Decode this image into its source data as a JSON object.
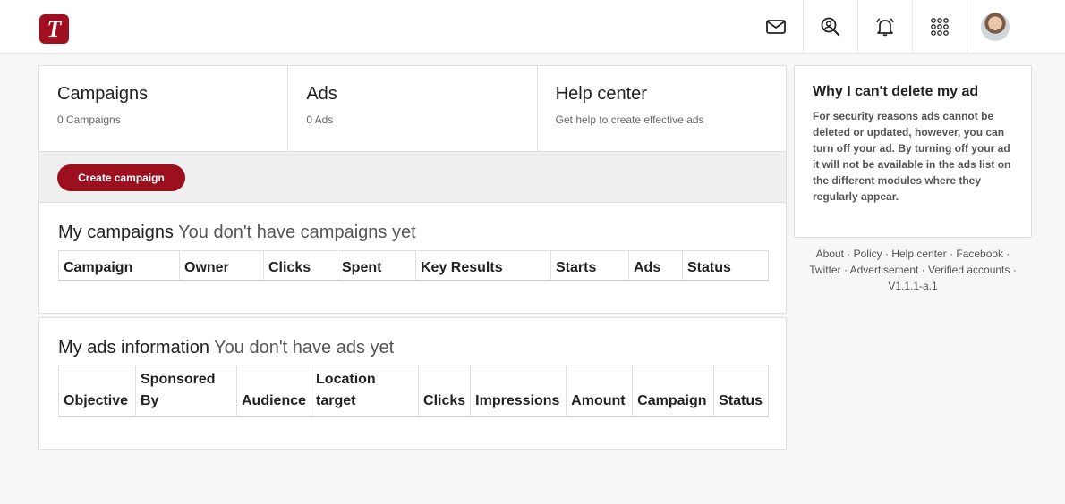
{
  "header": {
    "logo_letter": "T",
    "icons": [
      "mail-icon",
      "search-user-icon",
      "bell-icon",
      "apps-grid-icon"
    ]
  },
  "stats": [
    {
      "title": "Campaigns",
      "sub": "0 Campaigns"
    },
    {
      "title": "Ads",
      "sub": "0 Ads"
    },
    {
      "title": "Help center",
      "sub": "Get help to create effective ads"
    }
  ],
  "create_button": "Create campaign",
  "campaigns": {
    "title": "My campaigns",
    "subtitle": "You don't have campaigns yet",
    "columns": [
      "Campaign",
      "Owner",
      "Clicks",
      "Spent",
      "Key Results",
      "Starts",
      "Ads",
      "Status"
    ]
  },
  "ads": {
    "title": "My ads information",
    "subtitle": "You don't have ads yet",
    "columns": [
      "Objective",
      "Sponsored By",
      "Audience",
      "Location target",
      "Clicks",
      "Impressions",
      "Amount",
      "Campaign",
      "Status"
    ]
  },
  "sidebar": {
    "title": "Why I can't delete my ad",
    "body": "For security reasons ads cannot be deleted or updated, however, you can turn off your ad. By turning off your ad it will not be available in the ads list on the different modules where they regularly appear."
  },
  "footer": {
    "links": [
      "About",
      "Policy",
      "Help center",
      "Facebook",
      "Twitter",
      "Advertisement",
      "Verified accounts"
    ],
    "version": "V1.1.1-a.1"
  },
  "colors": {
    "brand": "#9c0f1e"
  }
}
